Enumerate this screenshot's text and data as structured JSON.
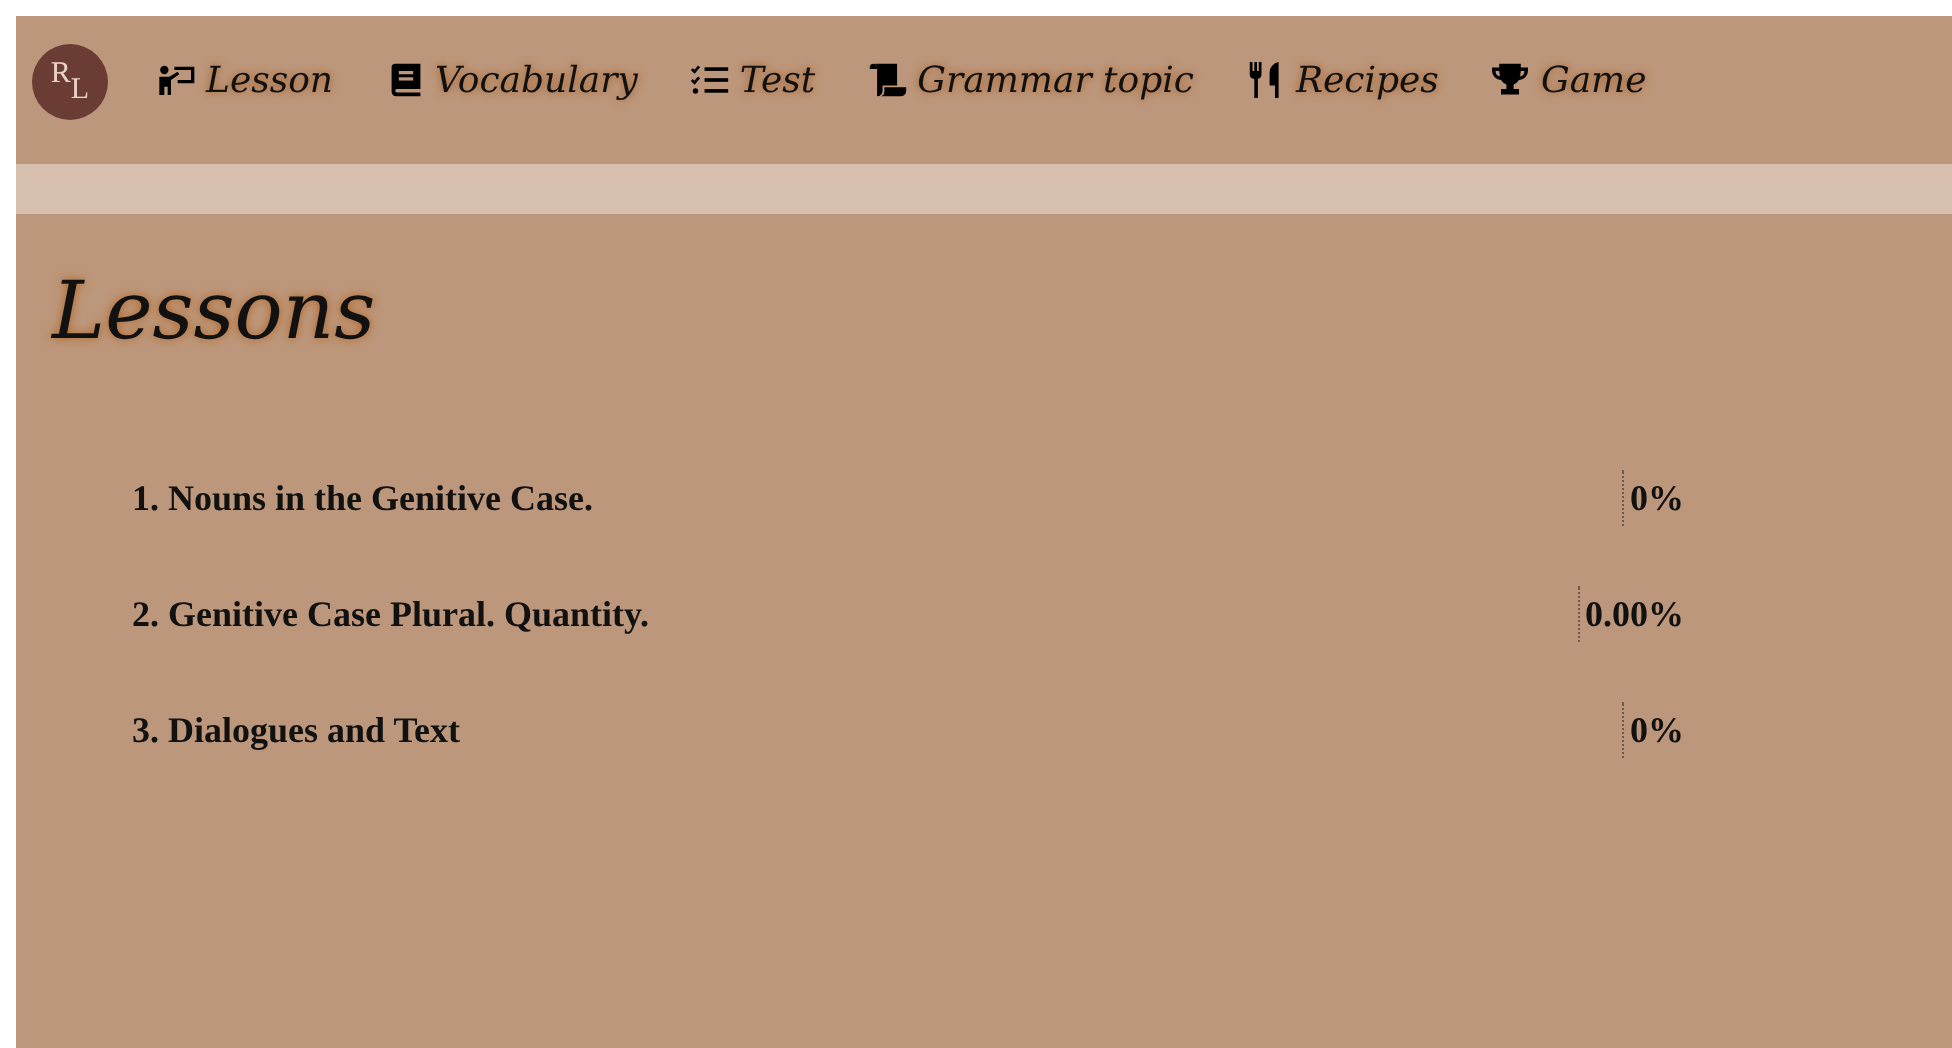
{
  "logo": {
    "text": "RL"
  },
  "nav": [
    {
      "label": "Lesson"
    },
    {
      "label": "Vocabulary"
    },
    {
      "label": "Test"
    },
    {
      "label": "Grammar topic"
    },
    {
      "label": "Recipes"
    },
    {
      "label": "Game"
    }
  ],
  "page": {
    "title": "Lessons"
  },
  "lessons": [
    {
      "title": "1. Nouns in the Genitive Case.",
      "progress": "0%"
    },
    {
      "title": "2. Genitive Case Plural. Quantity.",
      "progress": "0.00%"
    },
    {
      "title": "3. Dialogues and Text",
      "progress": "0%"
    }
  ]
}
